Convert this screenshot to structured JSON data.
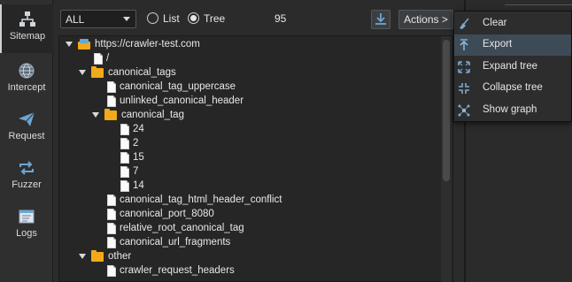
{
  "nav": [
    {
      "id": "sitemap",
      "label": "Sitemap",
      "icon": "sitemap-icon",
      "active": true
    },
    {
      "id": "intercept",
      "label": "Intercept",
      "icon": "globe-icon",
      "active": false
    },
    {
      "id": "request",
      "label": "Request",
      "icon": "paper-plane-icon",
      "active": false
    },
    {
      "id": "fuzzer",
      "label": "Fuzzer",
      "icon": "repeat-icon",
      "active": false
    },
    {
      "id": "logs",
      "label": "Logs",
      "icon": "log-window-icon",
      "active": false
    }
  ],
  "toolbar": {
    "filter_value": "ALL",
    "view_list_label": "List",
    "view_tree_label": "Tree",
    "selected_view": "Tree",
    "count": "95",
    "actions_label": "Actions >"
  },
  "tree": [
    {
      "label": "https://crawler-test.com",
      "type": "site",
      "depth": 0,
      "expanded": true
    },
    {
      "label": "/",
      "type": "page",
      "depth": 1
    },
    {
      "label": "canonical_tags",
      "type": "folder",
      "depth": 1,
      "expanded": true
    },
    {
      "label": "canonical_tag_uppercase",
      "type": "page",
      "depth": 2
    },
    {
      "label": "unlinked_canonical_header",
      "type": "page",
      "depth": 2
    },
    {
      "label": "canonical_tag",
      "type": "folder",
      "depth": 2,
      "expanded": true
    },
    {
      "label": "24",
      "type": "page",
      "depth": 3
    },
    {
      "label": "2",
      "type": "page",
      "depth": 3
    },
    {
      "label": "15",
      "type": "page",
      "depth": 3
    },
    {
      "label": "7",
      "type": "page",
      "depth": 3
    },
    {
      "label": "14",
      "type": "page",
      "depth": 3
    },
    {
      "label": "canonical_tag_html_header_conflict",
      "type": "page",
      "depth": 2
    },
    {
      "label": "canonical_port_8080",
      "type": "page",
      "depth": 2
    },
    {
      "label": "relative_root_canonical_tag",
      "type": "page",
      "depth": 2
    },
    {
      "label": "canonical_url_fragments",
      "type": "page",
      "depth": 2
    },
    {
      "label": "other",
      "type": "folder",
      "depth": 1,
      "expanded": true
    },
    {
      "label": "crawler_request_headers",
      "type": "page",
      "depth": 2
    }
  ],
  "actions_menu": {
    "items": [
      {
        "label": "Clear",
        "icon": "broom-icon",
        "hovered": false
      },
      {
        "label": "Export",
        "icon": "upload-arrow-icon",
        "hovered": true
      },
      {
        "label": "Expand tree",
        "icon": "expand-arrows-icon",
        "hovered": false
      },
      {
        "label": "Collapse tree",
        "icon": "collapse-arrows-icon",
        "hovered": false
      },
      {
        "label": "Show graph",
        "icon": "graph-nodes-icon",
        "hovered": false
      }
    ]
  },
  "colors": {
    "background": "#2b2b2b",
    "tree_background": "#262626",
    "folder": "#f2a91a",
    "menu_hover": "#3d4b57",
    "text": "#e6e6e6"
  }
}
